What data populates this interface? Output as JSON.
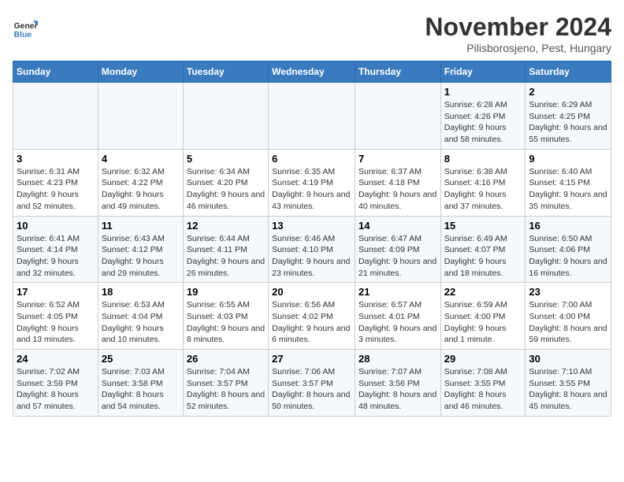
{
  "logo": {
    "name": "General",
    "name2": "Blue"
  },
  "title": "November 2024",
  "location": "Pilisborosjeno, Pest, Hungary",
  "headers": [
    "Sunday",
    "Monday",
    "Tuesday",
    "Wednesday",
    "Thursday",
    "Friday",
    "Saturday"
  ],
  "weeks": [
    [
      {
        "day": "",
        "info": ""
      },
      {
        "day": "",
        "info": ""
      },
      {
        "day": "",
        "info": ""
      },
      {
        "day": "",
        "info": ""
      },
      {
        "day": "",
        "info": ""
      },
      {
        "day": "1",
        "info": "Sunrise: 6:28 AM\nSunset: 4:26 PM\nDaylight: 9 hours\nand 58 minutes."
      },
      {
        "day": "2",
        "info": "Sunrise: 6:29 AM\nSunset: 4:25 PM\nDaylight: 9 hours\nand 55 minutes."
      }
    ],
    [
      {
        "day": "3",
        "info": "Sunrise: 6:31 AM\nSunset: 4:23 PM\nDaylight: 9 hours\nand 52 minutes."
      },
      {
        "day": "4",
        "info": "Sunrise: 6:32 AM\nSunset: 4:22 PM\nDaylight: 9 hours\nand 49 minutes."
      },
      {
        "day": "5",
        "info": "Sunrise: 6:34 AM\nSunset: 4:20 PM\nDaylight: 9 hours\nand 46 minutes."
      },
      {
        "day": "6",
        "info": "Sunrise: 6:35 AM\nSunset: 4:19 PM\nDaylight: 9 hours\nand 43 minutes."
      },
      {
        "day": "7",
        "info": "Sunrise: 6:37 AM\nSunset: 4:18 PM\nDaylight: 9 hours\nand 40 minutes."
      },
      {
        "day": "8",
        "info": "Sunrise: 6:38 AM\nSunset: 4:16 PM\nDaylight: 9 hours\nand 37 minutes."
      },
      {
        "day": "9",
        "info": "Sunrise: 6:40 AM\nSunset: 4:15 PM\nDaylight: 9 hours\nand 35 minutes."
      }
    ],
    [
      {
        "day": "10",
        "info": "Sunrise: 6:41 AM\nSunset: 4:14 PM\nDaylight: 9 hours\nand 32 minutes."
      },
      {
        "day": "11",
        "info": "Sunrise: 6:43 AM\nSunset: 4:12 PM\nDaylight: 9 hours\nand 29 minutes."
      },
      {
        "day": "12",
        "info": "Sunrise: 6:44 AM\nSunset: 4:11 PM\nDaylight: 9 hours\nand 26 minutes."
      },
      {
        "day": "13",
        "info": "Sunrise: 6:46 AM\nSunset: 4:10 PM\nDaylight: 9 hours\nand 23 minutes."
      },
      {
        "day": "14",
        "info": "Sunrise: 6:47 AM\nSunset: 4:09 PM\nDaylight: 9 hours\nand 21 minutes."
      },
      {
        "day": "15",
        "info": "Sunrise: 6:49 AM\nSunset: 4:07 PM\nDaylight: 9 hours\nand 18 minutes."
      },
      {
        "day": "16",
        "info": "Sunrise: 6:50 AM\nSunset: 4:06 PM\nDaylight: 9 hours\nand 16 minutes."
      }
    ],
    [
      {
        "day": "17",
        "info": "Sunrise: 6:52 AM\nSunset: 4:05 PM\nDaylight: 9 hours\nand 13 minutes."
      },
      {
        "day": "18",
        "info": "Sunrise: 6:53 AM\nSunset: 4:04 PM\nDaylight: 9 hours\nand 10 minutes."
      },
      {
        "day": "19",
        "info": "Sunrise: 6:55 AM\nSunset: 4:03 PM\nDaylight: 9 hours\nand 8 minutes."
      },
      {
        "day": "20",
        "info": "Sunrise: 6:56 AM\nSunset: 4:02 PM\nDaylight: 9 hours\nand 6 minutes."
      },
      {
        "day": "21",
        "info": "Sunrise: 6:57 AM\nSunset: 4:01 PM\nDaylight: 9 hours\nand 3 minutes."
      },
      {
        "day": "22",
        "info": "Sunrise: 6:59 AM\nSunset: 4:00 PM\nDaylight: 9 hours\nand 1 minute."
      },
      {
        "day": "23",
        "info": "Sunrise: 7:00 AM\nSunset: 4:00 PM\nDaylight: 8 hours\nand 59 minutes."
      }
    ],
    [
      {
        "day": "24",
        "info": "Sunrise: 7:02 AM\nSunset: 3:59 PM\nDaylight: 8 hours\nand 57 minutes."
      },
      {
        "day": "25",
        "info": "Sunrise: 7:03 AM\nSunset: 3:58 PM\nDaylight: 8 hours\nand 54 minutes."
      },
      {
        "day": "26",
        "info": "Sunrise: 7:04 AM\nSunset: 3:57 PM\nDaylight: 8 hours\nand 52 minutes."
      },
      {
        "day": "27",
        "info": "Sunrise: 7:06 AM\nSunset: 3:57 PM\nDaylight: 8 hours\nand 50 minutes."
      },
      {
        "day": "28",
        "info": "Sunrise: 7:07 AM\nSunset: 3:56 PM\nDaylight: 8 hours\nand 48 minutes."
      },
      {
        "day": "29",
        "info": "Sunrise: 7:08 AM\nSunset: 3:55 PM\nDaylight: 8 hours\nand 46 minutes."
      },
      {
        "day": "30",
        "info": "Sunrise: 7:10 AM\nSunset: 3:55 PM\nDaylight: 8 hours\nand 45 minutes."
      }
    ]
  ]
}
